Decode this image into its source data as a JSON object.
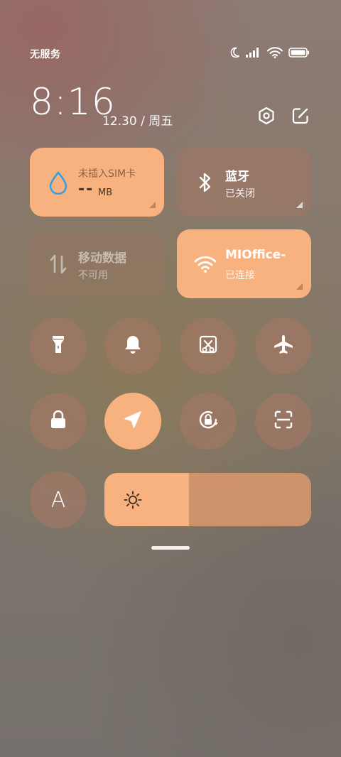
{
  "status_bar": {
    "carrier": "无服务",
    "icons": [
      "moon-icon",
      "signal-icon",
      "wifi-icon",
      "battery-icon"
    ]
  },
  "header": {
    "time": "8:16",
    "date": "12.30 / 周五",
    "actions": [
      "settings-icon",
      "edit-icon"
    ]
  },
  "tiles": {
    "data_usage": {
      "title": "未插入SIM卡",
      "value": "--",
      "unit": "MB"
    },
    "bluetooth": {
      "title": "蓝牙",
      "status": "已关闭"
    },
    "mobile_data": {
      "title": "移动数据",
      "status": "不可用"
    },
    "wifi": {
      "title": "MIOffice-",
      "status": "已连接"
    }
  },
  "toggles": [
    {
      "name": "flashlight-icon",
      "active": false
    },
    {
      "name": "bell-icon",
      "active": false
    },
    {
      "name": "screenshot-icon",
      "active": false
    },
    {
      "name": "airplane-icon",
      "active": false
    },
    {
      "name": "lock-icon",
      "active": false
    },
    {
      "name": "location-icon",
      "active": true
    },
    {
      "name": "rotation-lock-icon",
      "active": false
    },
    {
      "name": "scanner-icon",
      "active": false
    }
  ],
  "auto_brightness": {
    "label": "A"
  },
  "brightness": {
    "level": 0.41
  },
  "colors": {
    "accent": "#f7b27f",
    "tile_inactive": "#a07864",
    "droplet": "#3a9fe0"
  }
}
